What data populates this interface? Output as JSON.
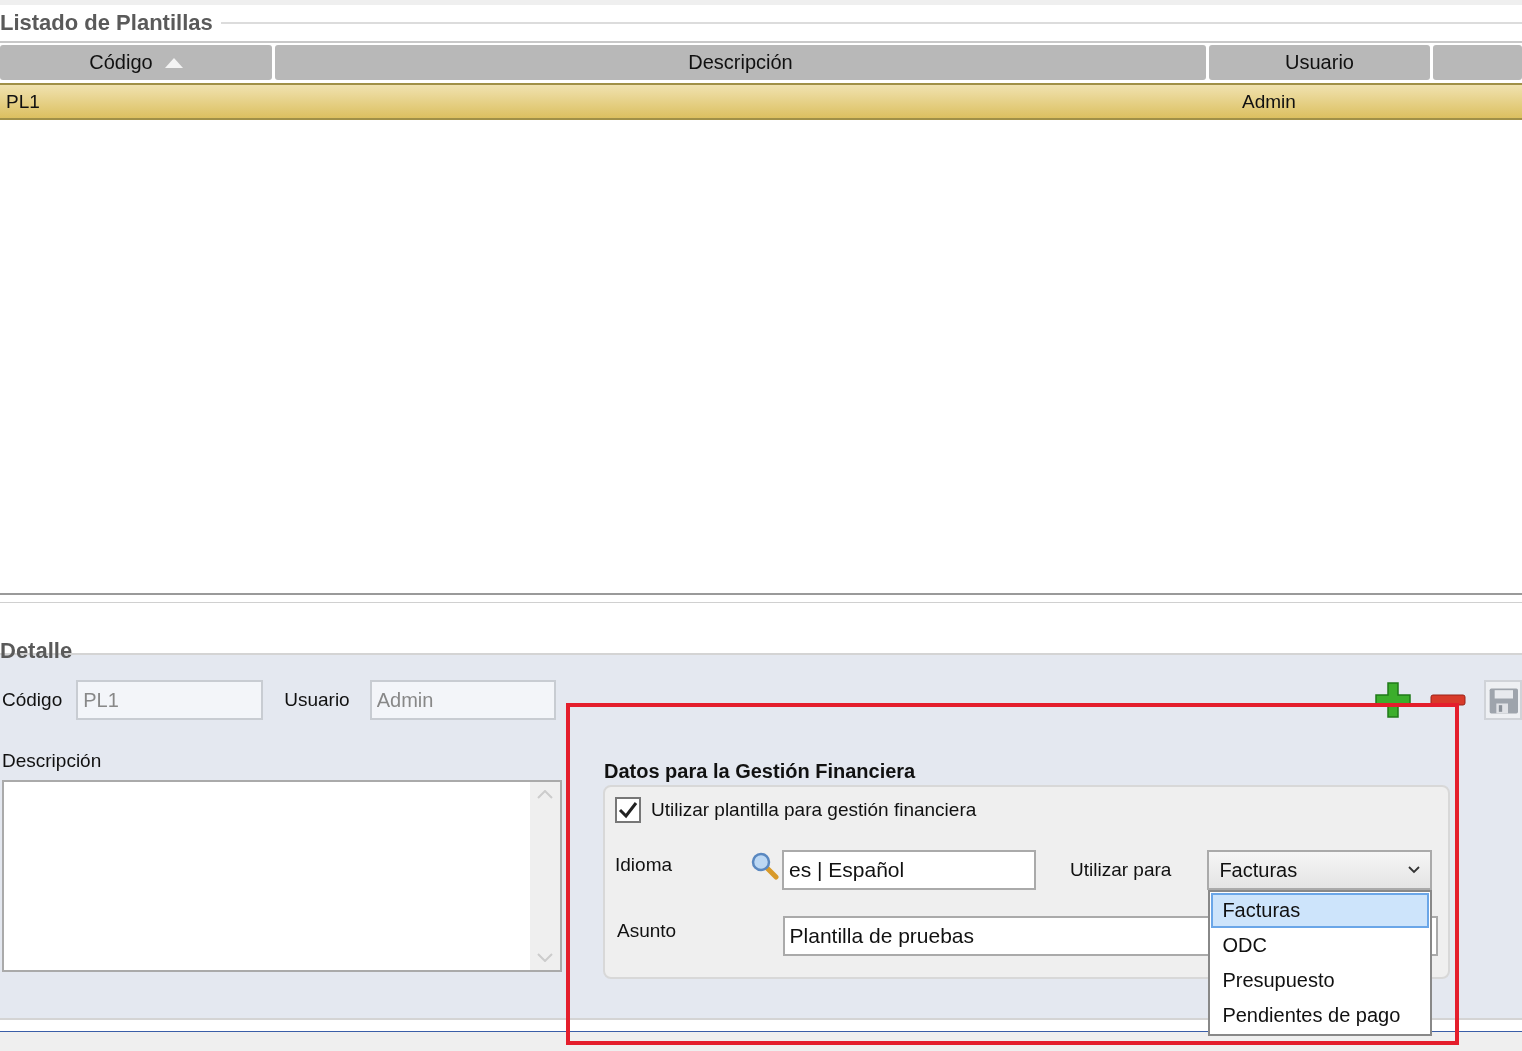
{
  "list_title": "Listado de Plantillas",
  "table": {
    "columns": [
      {
        "label": "Código",
        "sorted": true
      },
      {
        "label": "Descripción",
        "sorted": false
      },
      {
        "label": "Usuario",
        "sorted": false
      }
    ],
    "rows": [
      {
        "code": "PL1",
        "user": "Admin",
        "selected": true
      }
    ]
  },
  "detail": {
    "title": "Detalle",
    "code_label": "Código",
    "code_value": "PL1",
    "user_label": "Usuario",
    "user_value": "Admin",
    "description_label": "Descripción"
  },
  "financial": {
    "title": "Datos para la Gestión Financiera",
    "use_template": {
      "label": "Utilizar plantilla para gestión financiera",
      "checked": true
    },
    "language_label": "Idioma",
    "language_value": "es | Español",
    "use_for_label": "Utilizar para",
    "use_for_value": "Facturas",
    "dropdown": {
      "expanded": true,
      "options": [
        {
          "label": "Facturas",
          "selected": true
        },
        {
          "label": "ODC",
          "selected": false
        },
        {
          "label": "Presupuesto",
          "selected": false
        },
        {
          "label": "Pendientes de pago",
          "selected": false
        }
      ]
    },
    "subject_label": "Asunto",
    "subject_value": "Plantilla de pruebas"
  }
}
